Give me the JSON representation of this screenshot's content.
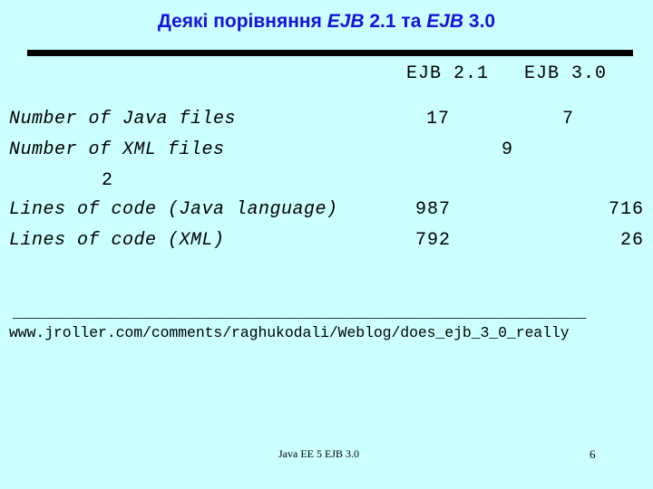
{
  "slide": {
    "title_prefix": "Деякі порівняння ",
    "title_ejb1": "EJB",
    "title_mid1": " 2.1 та ",
    "title_ejb2": "EJB",
    "title_mid2": " 3.0",
    "background_color": "#ccffff",
    "title_color": "#1414d8",
    "rule_color": "#000000"
  },
  "table": {
    "headers": {
      "ejb21": "EJB 2.1",
      "ejb30": "EJB 3.0"
    },
    "rows": [
      {
        "label": "Number of Java files",
        "ejb21": "17",
        "ejb30": "7"
      },
      {
        "label": "Number of XML files",
        "ejb21": "9",
        "ejb30": "2"
      },
      {
        "label": "Lines of code (Java language)",
        "ejb21": "987",
        "ejb30": "716"
      },
      {
        "label": "Lines of code (XML)",
        "ejb21": "792",
        "ejb30": "26"
      }
    ]
  },
  "source": {
    "rule": "______________________________________________________________",
    "url": "www.jroller.com/comments/raghukodali/Weblog/does_ejb_3_0_really"
  },
  "footer": {
    "text": "Java EE 5 EJB 3.0",
    "page": "6"
  }
}
